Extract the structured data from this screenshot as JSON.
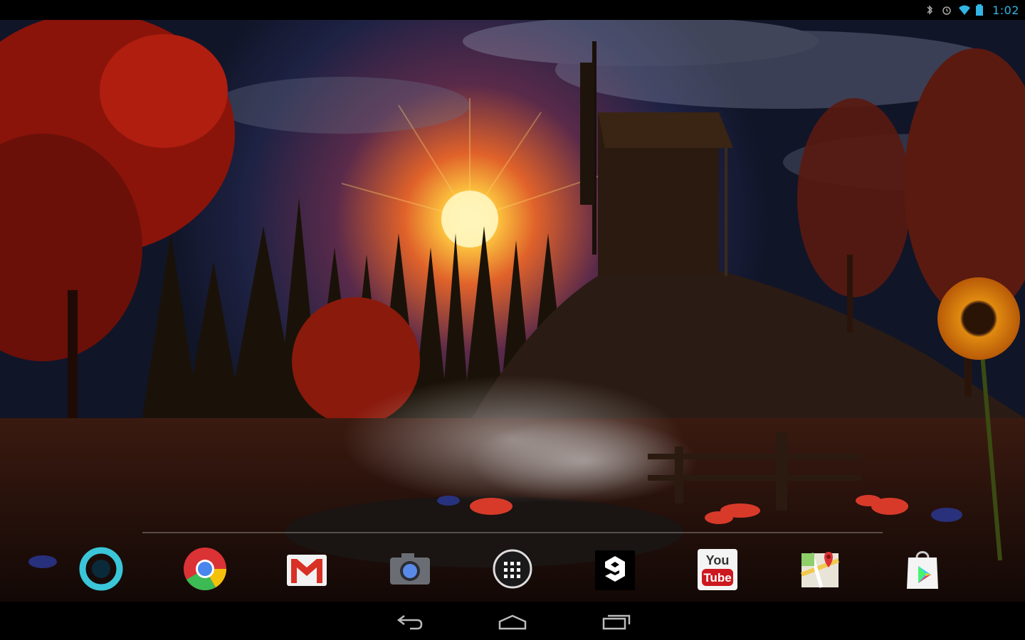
{
  "status_bar": {
    "time": "1:02",
    "icons": [
      "bluetooth-icon",
      "alarm-icon",
      "wifi-icon",
      "battery-icon"
    ],
    "accent_color": "#33b5e5"
  },
  "wallpaper": {
    "description_colors": {
      "sky": "#1c2240",
      "sun": "#ffd24a",
      "foliage": "#9b1a0e"
    }
  },
  "dock": {
    "items": [
      {
        "id": "screen-lock-app",
        "icon": "ring-icon"
      },
      {
        "id": "chrome",
        "icon": "chrome-icon"
      },
      {
        "id": "gmail",
        "icon": "gmail-icon"
      },
      {
        "id": "camera",
        "icon": "camera-icon"
      },
      {
        "id": "all-apps",
        "icon": "app-drawer-icon"
      },
      {
        "id": "9gag",
        "icon": "ninegag-icon"
      },
      {
        "id": "youtube",
        "icon": "youtube-icon",
        "label_top": "You",
        "label_bottom": "Tube"
      },
      {
        "id": "maps",
        "icon": "maps-icon"
      },
      {
        "id": "play-store",
        "icon": "play-store-icon"
      }
    ]
  },
  "nav_bar": {
    "buttons": [
      "back",
      "home",
      "recents"
    ]
  }
}
